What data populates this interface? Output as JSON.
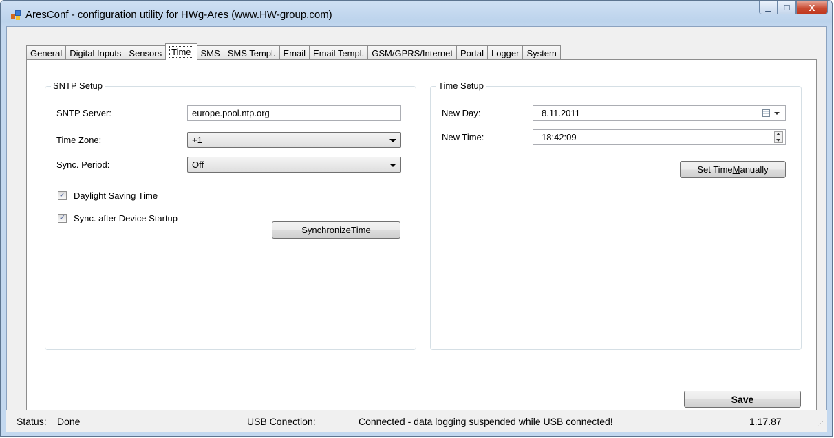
{
  "window": {
    "title": "AresConf - configuration utility for HWg-Ares (www.HW-group.com)",
    "controls": {
      "minimize": "▁",
      "maximize": "☐",
      "close": "X"
    }
  },
  "tabs": [
    "General",
    "Digital Inputs",
    "Sensors",
    "Time",
    "SMS",
    "SMS Templ.",
    "Email",
    "Email Templ.",
    "GSM/GPRS/Internet",
    "Portal",
    "Logger",
    "System"
  ],
  "active_tab": "Time",
  "sntp": {
    "group_title": "SNTP Setup",
    "server_label": "SNTP Server:",
    "server_value": "europe.pool.ntp.org",
    "timezone_label": "Time Zone:",
    "timezone_value": "+1",
    "period_label": "Sync. Period:",
    "period_value": "Off",
    "dst_label": "Daylight Saving Time",
    "dst_checked": true,
    "startup_label": "Sync. after Device Startup",
    "startup_checked": true,
    "sync_btn": {
      "pre": "Synchronize ",
      "key": "T",
      "post": "ime"
    }
  },
  "timesetup": {
    "group_title": "Time Setup",
    "day_label": "New Day:",
    "day_value": "8.11.2011",
    "time_label": "New Time:",
    "time_value": "18:42:09",
    "set_btn": {
      "pre": "Set Time ",
      "key": "M",
      "post": "anually"
    }
  },
  "save_btn": {
    "key": "S",
    "post": "ave"
  },
  "status": {
    "label": "Status:",
    "value": "Done",
    "usb_label": "USB Conection:",
    "usb_value": "Connected - data logging suspended while USB connected!",
    "version": "1.17.87"
  },
  "icons": {
    "check": "✓",
    "grip": "⋰"
  }
}
